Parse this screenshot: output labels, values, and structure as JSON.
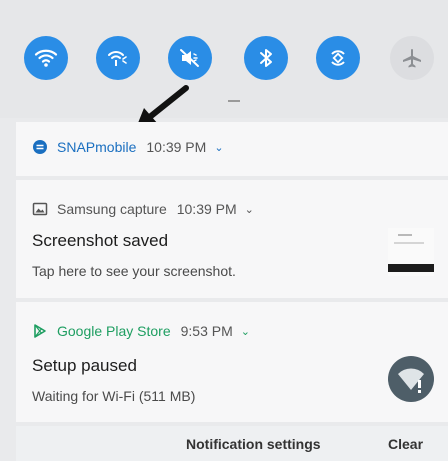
{
  "quick_settings": {
    "tiles": [
      {
        "icon": "wifi-icon",
        "active": true
      },
      {
        "icon": "mobile-hotspot-icon",
        "active": true
      },
      {
        "icon": "sound-mute-icon",
        "active": true
      },
      {
        "icon": "bluetooth-icon",
        "active": true
      },
      {
        "icon": "auto-rotate-icon",
        "active": true
      },
      {
        "icon": "airplane-mode-icon",
        "active": false
      }
    ],
    "accent_color": "#2a8de6"
  },
  "notifications": [
    {
      "app": "SNAPmobile",
      "time": "10:39 PM",
      "app_color": "#1a6fc0"
    },
    {
      "app": "Samsung capture",
      "time": "10:39 PM",
      "title": "Screenshot saved",
      "text": "Tap here to see your screenshot."
    },
    {
      "app": "Google Play Store",
      "time": "9:53 PM",
      "title": "Setup paused",
      "text": "Waiting for Wi-Fi (511 MB)",
      "app_color": "#1e9e61"
    }
  ],
  "footer": {
    "settings_label": "Notification settings",
    "clear_label": "Clear"
  }
}
